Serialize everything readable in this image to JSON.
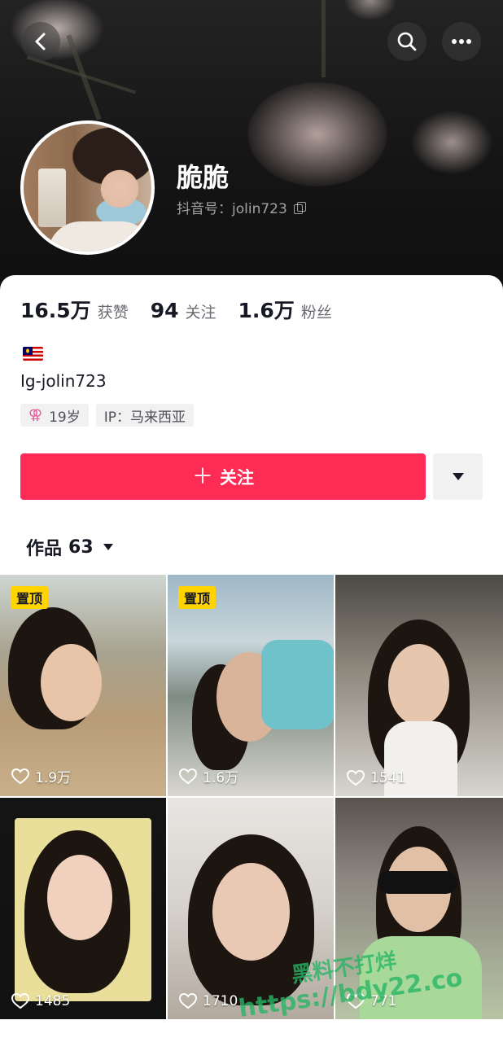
{
  "header": {
    "name": "脆脆",
    "douyin_id": "抖音号：jolin723"
  },
  "stats": [
    {
      "value": "16.5万",
      "label": "获赞"
    },
    {
      "value": "94",
      "label": "关注"
    },
    {
      "value": "1.6万",
      "label": "粉丝"
    }
  ],
  "profile": {
    "bio": "Ig-jolin723",
    "age_tag": "19岁",
    "ip_tag": "IP：马来西亚",
    "gender_symbol": "⚢"
  },
  "actions": {
    "follow_label": "关注",
    "plus": "＋"
  },
  "works": {
    "label": "作品",
    "count": "63"
  },
  "videos": [
    {
      "pinned": "置顶",
      "likes": "1.9万"
    },
    {
      "pinned": "置顶",
      "likes": "1.6万"
    },
    {
      "likes": "1541"
    },
    {
      "likes": "1485"
    },
    {
      "likes": "1710"
    },
    {
      "likes": "771"
    }
  ],
  "watermark": {
    "line1": "黑料不打烊",
    "line2": "https://bdy22.co"
  },
  "colors": {
    "accent": "#fe2c55",
    "pin_badge": "#ffd400"
  }
}
